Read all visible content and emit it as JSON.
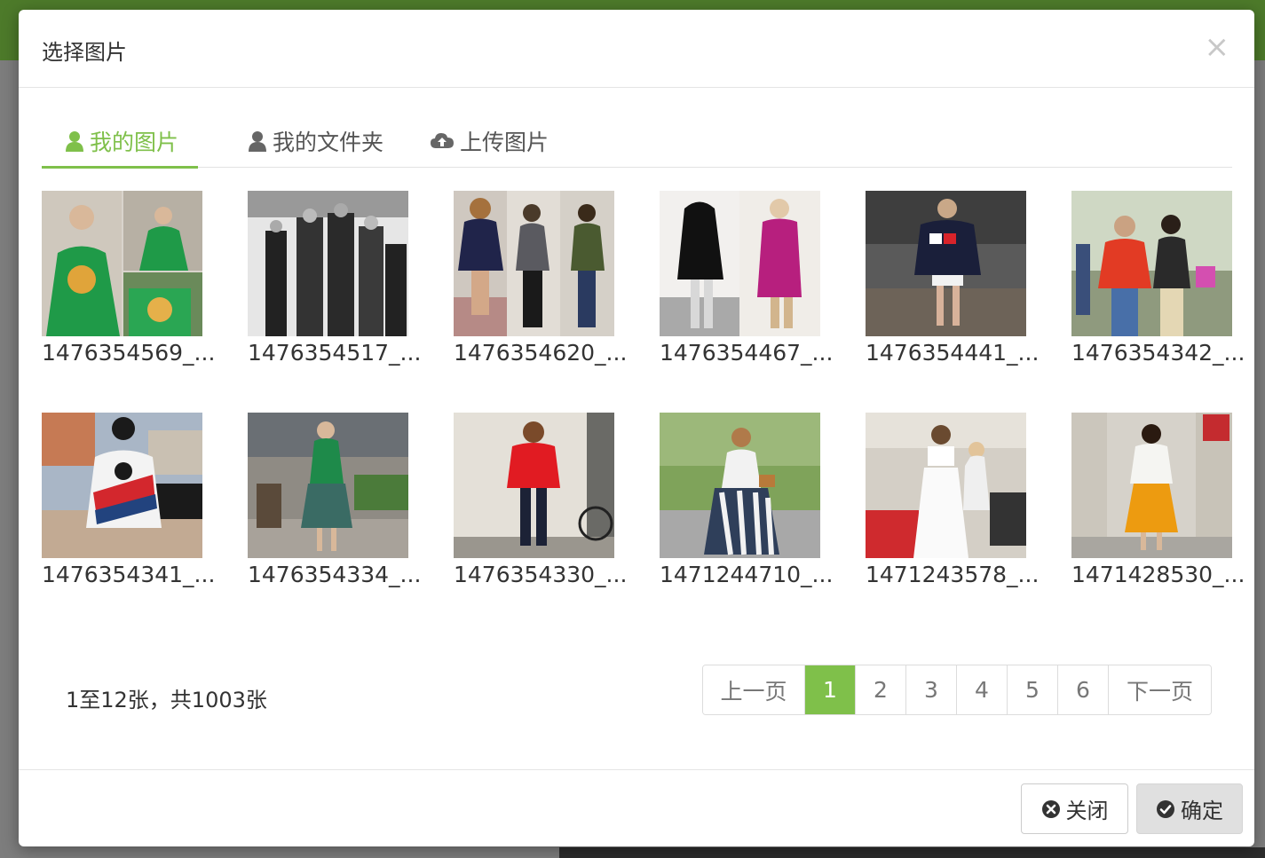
{
  "modal": {
    "title": "选择图片",
    "close_symbol": "×"
  },
  "tabs": [
    {
      "label": "我的图片",
      "icon": "user-icon",
      "active": true
    },
    {
      "label": "我的文件夹",
      "icon": "user-icon",
      "active": false
    },
    {
      "label": "上传图片",
      "icon": "cloud-upload-icon",
      "active": false
    }
  ],
  "images": [
    {
      "caption": "1476354569_..."
    },
    {
      "caption": "1476354517_..."
    },
    {
      "caption": "1476354620_..."
    },
    {
      "caption": "1476354467_..."
    },
    {
      "caption": "1476354441_..."
    },
    {
      "caption": "1476354342_..."
    },
    {
      "caption": "1476354341_..."
    },
    {
      "caption": "1476354334_..."
    },
    {
      "caption": "1476354330_..."
    },
    {
      "caption": "1471244710_..."
    },
    {
      "caption": "1471243578_..."
    },
    {
      "caption": "1471428530_..."
    }
  ],
  "pagination": {
    "range_text": "1至12张，共1003张",
    "prev_label": "上一页",
    "next_label": "下一页",
    "pages": [
      "1",
      "2",
      "3",
      "4",
      "5",
      "6"
    ],
    "current": "1"
  },
  "footer": {
    "close_label": "关闭",
    "confirm_label": "确定"
  },
  "colors": {
    "accent": "#7fc04a",
    "topbar": "#4d7a2a"
  }
}
